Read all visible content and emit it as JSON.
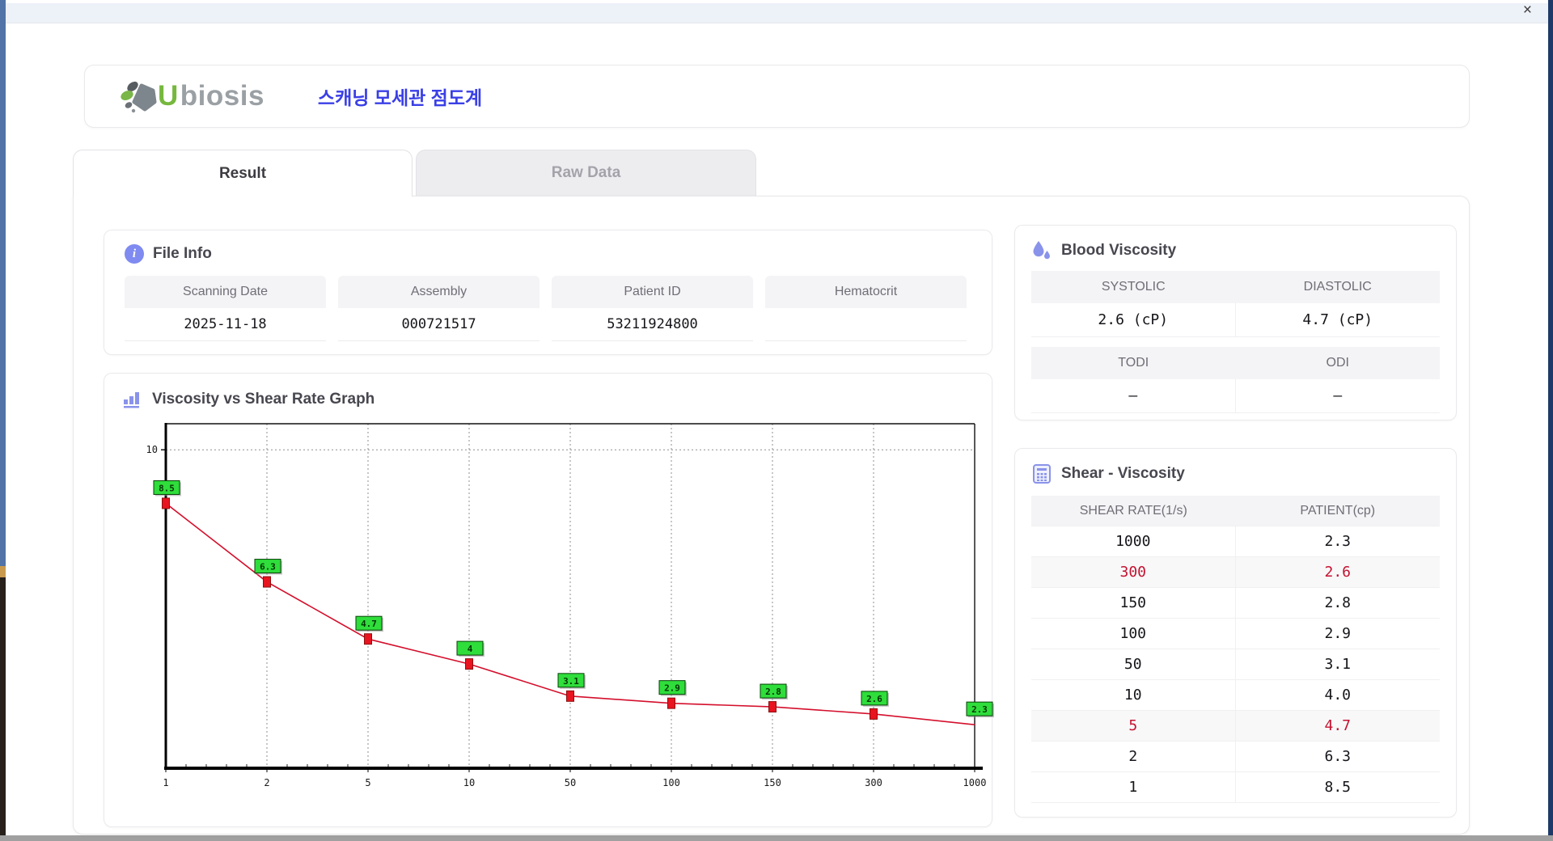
{
  "window": {
    "close_label": "×"
  },
  "header": {
    "brand_u": "U",
    "brand_rest": "biosis",
    "app_title_ko": "스캐닝 모세관 점도계"
  },
  "tabs": [
    {
      "label": "Result",
      "active": true
    },
    {
      "label": "Raw Data",
      "active": false
    }
  ],
  "file_info": {
    "title": "File Info",
    "fields": [
      {
        "label": "Scanning Date",
        "value": "2025-11-18"
      },
      {
        "label": "Assembly",
        "value": "000721517"
      },
      {
        "label": "Patient ID",
        "value": "53211924800"
      },
      {
        "label": "Hematocrit",
        "value": ""
      }
    ]
  },
  "blood_viscosity": {
    "title": "Blood Viscosity",
    "groups": [
      {
        "cols": [
          {
            "label": "SYSTOLIC",
            "value": "2.6 (cP)"
          },
          {
            "label": "DIASTOLIC",
            "value": "4.7 (cP)"
          }
        ]
      },
      {
        "cols": [
          {
            "label": "TODI",
            "value": "–"
          },
          {
            "label": "ODI",
            "value": "–"
          }
        ]
      }
    ]
  },
  "shear_viscosity": {
    "title": "Shear - Viscosity",
    "columns": [
      "SHEAR RATE(1/s)",
      "PATIENT(cp)"
    ],
    "rows": [
      {
        "shear_rate": "1000",
        "patient": "2.3",
        "highlight": false
      },
      {
        "shear_rate": "300",
        "patient": "2.6",
        "highlight": true
      },
      {
        "shear_rate": "150",
        "patient": "2.8",
        "highlight": false
      },
      {
        "shear_rate": "100",
        "patient": "2.9",
        "highlight": false
      },
      {
        "shear_rate": "50",
        "patient": "3.1",
        "highlight": false
      },
      {
        "shear_rate": "10",
        "patient": "4.0",
        "highlight": false
      },
      {
        "shear_rate": "5",
        "patient": "4.7",
        "highlight": true
      },
      {
        "shear_rate": "2",
        "patient": "6.3",
        "highlight": false
      },
      {
        "shear_rate": "1",
        "patient": "8.5",
        "highlight": false
      }
    ],
    "highlight_color": "#c41230"
  },
  "chart_data": {
    "type": "line",
    "title": "Viscosity vs Shear Rate Graph",
    "x": [
      1,
      2,
      5,
      10,
      50,
      100,
      150,
      300,
      1000
    ],
    "x_tick_labels": [
      "1",
      "2",
      "5",
      "10",
      "50",
      "100",
      "150",
      "300",
      "1000"
    ],
    "series": [
      {
        "name": "PATIENT",
        "values": [
          8.5,
          6.3,
          4.7,
          4.0,
          3.1,
          2.9,
          2.8,
          2.6,
          2.3
        ]
      }
    ],
    "point_labels": [
      "8.5",
      "6.3",
      "4.7",
      "4",
      "3.1",
      "2.9",
      "2.8",
      "2.6",
      "2.3"
    ],
    "xlabel": "",
    "ylabel": "",
    "x_scale": "categorical",
    "y_axis": {
      "min": 1.08,
      "max": 10.73,
      "gridline_value": 10,
      "tick_labels": [
        "10"
      ]
    },
    "grid": "dashed",
    "legend": "none",
    "line_color": "#d40f2c",
    "marker_color": "#e8141f",
    "label_bg": "#2fdd3b"
  }
}
